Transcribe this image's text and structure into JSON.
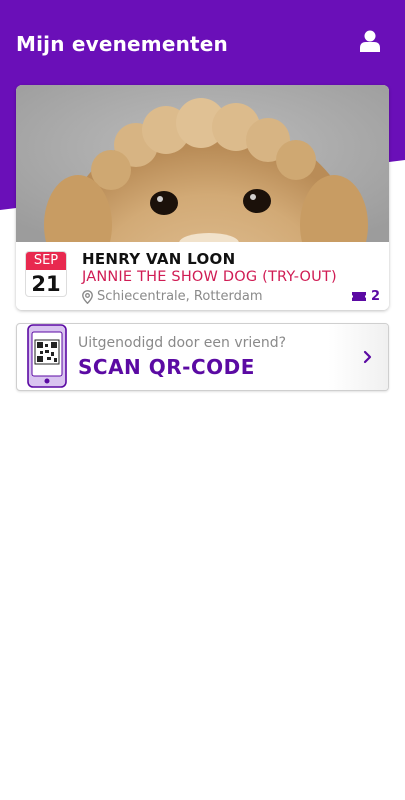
{
  "header": {
    "title": "Mijn evenementen",
    "profile_icon": "user-icon",
    "bg_color": "#6a0fb8"
  },
  "events": [
    {
      "date": {
        "month": "SEP",
        "day": "21"
      },
      "artist": "HENRY VAN LOON",
      "show": "JANNIE THE SHOW DOG (TRY-OUT)",
      "venue": "Schiecentrale, Rotterdam",
      "venue_icon": "location-pin-icon",
      "tickets": {
        "icon": "ticket-icon",
        "count": "2"
      },
      "image_icon": "dog-photo"
    }
  ],
  "scan": {
    "prompt": "Uitgenodigd door een vriend?",
    "label": "SCAN QR-CODE",
    "icon": "phone-qr-icon",
    "chevron": "chevron-right-icon"
  },
  "colors": {
    "brand_purple": "#5b0aa3",
    "accent_red": "#e8294f",
    "show_title": "#d01c54"
  }
}
